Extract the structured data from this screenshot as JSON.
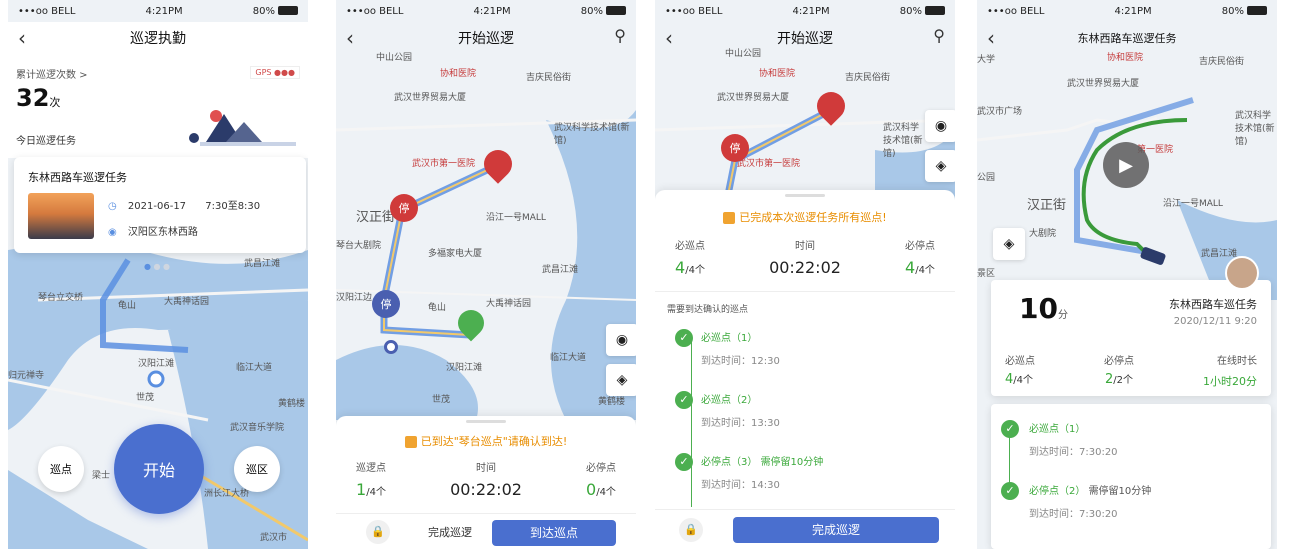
{
  "status_bar": {
    "carrier": "•••oo BELL",
    "time": "4:21PM",
    "battery": "80%"
  },
  "colors": {
    "accent": "#4a6fcf",
    "green": "#3aa83a",
    "orange": "#e88d00",
    "red_pin": "#d03a3a",
    "route": "#5a8fe0"
  },
  "screen1": {
    "title": "巡逻执勤",
    "cumulative_label": "累计巡逻次数 >",
    "gps_label": "GPS",
    "count": "32",
    "count_unit": "次",
    "today_label": "今日巡逻任务",
    "task": {
      "name": "东林西路车巡逻任务",
      "date": "2021-06-17",
      "time": "7:30至8:30",
      "location": "汉阳区东林西路"
    },
    "buttons": {
      "left": "巡点",
      "start": "开始",
      "right": "巡区"
    },
    "map_labels": [
      "琴台立交桥",
      "龟山",
      "大禹神话园",
      "汉阳江滩",
      "武昌江滩",
      "世茂",
      "临江大道",
      "黄鹤楼",
      "武汉音乐学院",
      "归元禅寺",
      "洲长江大桥",
      "武汉市",
      "梁士"
    ]
  },
  "screen2": {
    "title": "开始巡逻",
    "notice": "已到达\"琴台巡点\"请确认到达!",
    "stats": {
      "patrol_label": "巡逻点",
      "patrol_done": "1",
      "patrol_total": "/4个",
      "time_label": "时间",
      "time": "00:22:02",
      "stop_label": "必停点",
      "stop_done": "0",
      "stop_total": "/4个"
    },
    "finish_label": "完成巡逻",
    "arrive_label": "到达巡点",
    "pin_stop": "停",
    "map_labels": [
      "中山公园",
      "协和医院",
      "武汉世界贸易大厦",
      "吉庆民俗街",
      "汉正街",
      "武汉科学技术馆(新馆)",
      "武汉市第一医院",
      "沿江一号MALL",
      "多福家电大厦",
      "琴台大剧院",
      "龟山",
      "大禹神话园",
      "汉阳江滩",
      "武昌江滩",
      "世茂",
      "临江大道",
      "黄鹤楼",
      "汉阳江边"
    ]
  },
  "screen3": {
    "title": "开始巡逻",
    "notice": "已完成本次巡逻任务所有巡点!",
    "stats": {
      "patrol_label": "必巡点",
      "patrol_done": "4",
      "patrol_total": "/4个",
      "time_label": "时间",
      "time": "00:22:02",
      "stop_label": "必停点",
      "stop_done": "4",
      "stop_total": "/4个"
    },
    "list_title": "需要到达确认的巡点",
    "items": [
      {
        "title": "必巡点（1）",
        "extra": "",
        "time": "到达时间：12:30"
      },
      {
        "title": "必巡点（2）",
        "extra": "",
        "time": "到达时间：13:30"
      },
      {
        "title": "必停点（3）",
        "extra": "需停留10分钟",
        "time": "到达时间：14:30"
      }
    ],
    "finish_button": "完成巡逻",
    "pin_stop": "停",
    "map_labels": [
      "中山公园",
      "协和医院",
      "武汉世界贸易大厦",
      "吉庆民俗街",
      "武汉科学技术馆(新馆)",
      "武汉市第一医院"
    ]
  },
  "screen4": {
    "title": "东林西路车巡逻任务",
    "duration": "10",
    "duration_unit": "分",
    "task_name": "东林西路车巡任务",
    "datetime": "2020/12/11 9:20",
    "stats": {
      "patrol_label": "必巡点",
      "patrol_done": "4",
      "patrol_total": "/4个",
      "stop_label": "必停点",
      "stop_done": "2",
      "stop_total": "/2个",
      "online_label": "在线时长",
      "online_value": "1小时20分"
    },
    "items": [
      {
        "title": "必巡点（1）",
        "extra": "",
        "time": "到达时间：7:30:20"
      },
      {
        "title": "必停点（2）",
        "extra": "需停留10分钟",
        "time": "到达时间：7:30:20"
      }
    ],
    "map_labels": [
      "协和医院",
      "武汉世界贸易大厦",
      "吉庆民俗街",
      "汉正街",
      "武汉科学技术馆(新馆)",
      "第一医院",
      "沿江一号MALL",
      "大剧院",
      "武昌江滩",
      "武汉市广场",
      "大学",
      "公园",
      "景区"
    ]
  }
}
